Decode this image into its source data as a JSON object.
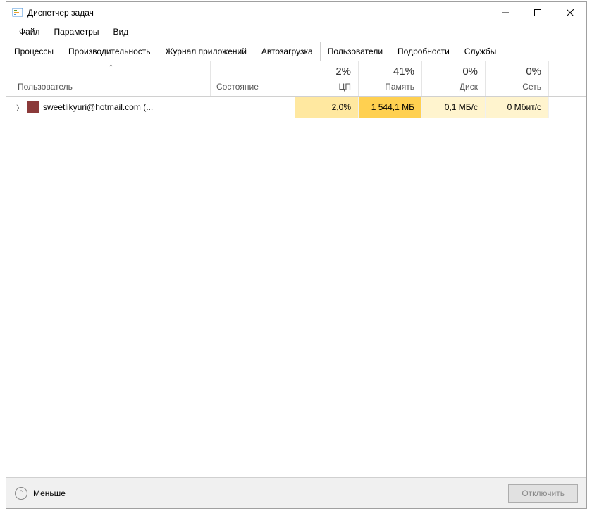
{
  "window": {
    "title": "Диспетчер задач"
  },
  "menu": {
    "file": "Файл",
    "options": "Параметры",
    "view": "Вид"
  },
  "tabs": {
    "processes": "Процессы",
    "performance": "Производительность",
    "app_history": "Журнал приложений",
    "startup": "Автозагрузка",
    "users": "Пользователи",
    "details": "Подробности",
    "services": "Службы",
    "active": "users"
  },
  "columns": {
    "user": "Пользователь",
    "status": "Состояние",
    "cpu": {
      "value": "2%",
      "label": "ЦП"
    },
    "memory": {
      "value": "41%",
      "label": "Память"
    },
    "disk": {
      "value": "0%",
      "label": "Диск"
    },
    "network": {
      "value": "0%",
      "label": "Сеть"
    }
  },
  "rows": [
    {
      "username": "sweetlikyuri@hotmail.com (...",
      "status": "",
      "cpu": "2,0%",
      "memory": "1 544,1 МБ",
      "disk": "0,1 МБ/с",
      "network": "0 Мбит/с"
    }
  ],
  "footer": {
    "fewer": "Меньше",
    "disconnect": "Отключить"
  },
  "colors": {
    "heat_light": "#fff4ce",
    "heat_med": "#ffe8a0",
    "heat_strong": "#ffd050"
  }
}
